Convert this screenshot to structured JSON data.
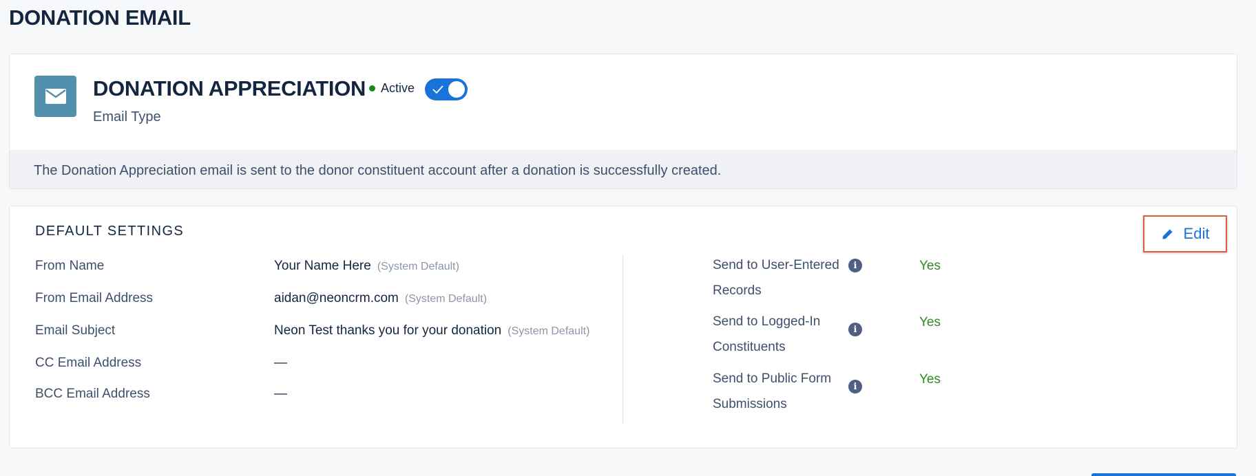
{
  "page": {
    "title": "DONATION EMAIL"
  },
  "email_type": {
    "icon": "envelope-icon",
    "name": "DONATION APPRECIATION",
    "status": "Active",
    "active": true,
    "subtitle": "Email Type",
    "description": "The Donation Appreciation email is sent to the donor constituent account after a donation is successfully created."
  },
  "default_settings": {
    "title": "DEFAULT SETTINGS",
    "edit_label": "Edit",
    "edit_icon": "pencil-icon",
    "fields": [
      {
        "label": "From Name",
        "value": "Your Name Here",
        "note": "(System Default)"
      },
      {
        "label": "From Email Address",
        "value": "aidan@neoncrm.com",
        "note": "(System Default)"
      },
      {
        "label": "Email Subject",
        "value": "Neon Test thanks you for your donation",
        "note": "(System Default)"
      },
      {
        "label": "CC Email Address",
        "value": "—",
        "note": ""
      },
      {
        "label": "BCC Email Address",
        "value": "—",
        "note": ""
      }
    ],
    "options": [
      {
        "label_line1": "Send to User-Entered",
        "label_line2": "Records",
        "value": "Yes"
      },
      {
        "label_line1": "Send to Logged-In",
        "label_line2": "Constituents",
        "value": "Yes"
      },
      {
        "label_line1": "Send to Public Form",
        "label_line2": "Submissions",
        "value": "Yes"
      }
    ]
  },
  "colors": {
    "accent": "#1a73d9",
    "heading": "#14263f",
    "text": "#3d4f6b",
    "success": "#2e8b1f",
    "badge": "#5290ad",
    "highlight": "#e05a48"
  }
}
